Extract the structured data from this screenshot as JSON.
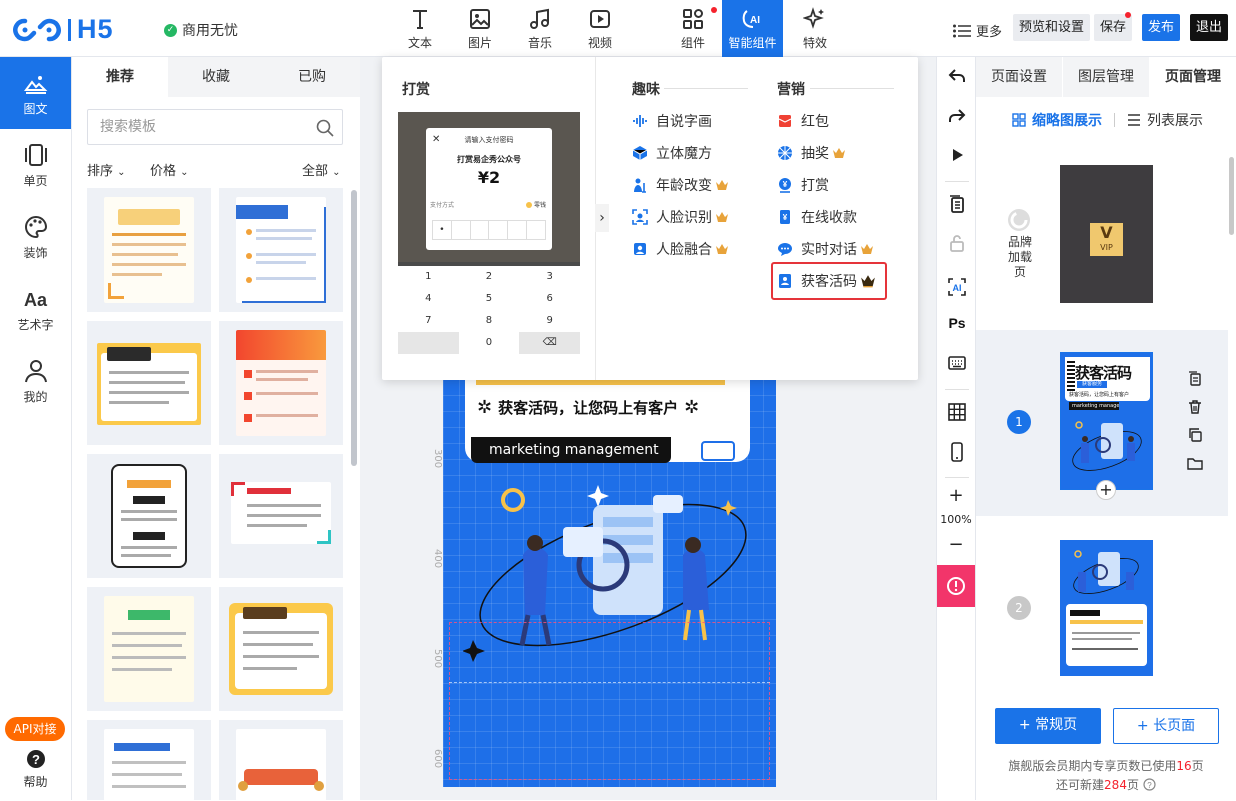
{
  "app": {
    "logo": "H5",
    "commercial": "商用无忧"
  },
  "toolbar": {
    "tools": [
      {
        "label": "文本",
        "icon": "text-icon"
      },
      {
        "label": "图片",
        "icon": "image-icon"
      },
      {
        "label": "音乐",
        "icon": "music-icon"
      },
      {
        "label": "视频",
        "icon": "video-icon"
      },
      {
        "label": "组件",
        "icon": "component-icon"
      },
      {
        "label": "智能组件",
        "icon": "ai-component-icon"
      },
      {
        "label": "特效",
        "icon": "effects-icon"
      }
    ],
    "more": "更多",
    "preview": "预览和设置",
    "save": "保存",
    "publish": "发布",
    "exit": "退出"
  },
  "leftnav": [
    {
      "label": "图文",
      "icon": "graphic-text-icon"
    },
    {
      "label": "单页",
      "icon": "single-page-icon"
    },
    {
      "label": "装饰",
      "icon": "palette-icon"
    },
    {
      "label": "艺术字",
      "icon": "art-text-icon"
    },
    {
      "label": "我的",
      "icon": "user-icon"
    }
  ],
  "leftnav_bottom": {
    "api": "API对接",
    "help": "帮助"
  },
  "templates": {
    "tabs": [
      "推荐",
      "收藏",
      "已购"
    ],
    "search_placeholder": "搜索模板",
    "filters": {
      "sort": "排序",
      "price": "价格",
      "all": "全部"
    }
  },
  "popup": {
    "reward": {
      "title": "打赏",
      "phone": {
        "header": "请输入支付密码",
        "merchant": "打赏易企秀公众号",
        "amount": "¥2",
        "method": "支付方式",
        "method_value": "零钱",
        "keys": [
          "1",
          "2",
          "3",
          "4",
          "5",
          "6",
          "7",
          "8",
          "9",
          "",
          "0",
          "⌫"
        ]
      }
    },
    "fun": {
      "title": "趣味",
      "items": [
        {
          "label": "自说字画",
          "icon": "voice-wave-icon",
          "crown": false
        },
        {
          "label": "立体魔方",
          "icon": "cube-icon",
          "crown": false
        },
        {
          "label": "年龄改变",
          "icon": "age-change-icon",
          "crown": true
        },
        {
          "label": "人脸识别",
          "icon": "face-recognition-icon",
          "crown": true
        },
        {
          "label": "人脸融合",
          "icon": "face-merge-icon",
          "crown": true
        }
      ]
    },
    "marketing": {
      "title": "营销",
      "items": [
        {
          "label": "红包",
          "icon": "red-envelope-icon",
          "crown": false
        },
        {
          "label": "抽奖",
          "icon": "lottery-icon",
          "crown": true
        },
        {
          "label": "打赏",
          "icon": "reward-icon",
          "crown": false
        },
        {
          "label": "在线收款",
          "icon": "payment-icon",
          "crown": false
        },
        {
          "label": "实时对话",
          "icon": "chat-icon",
          "crown": true
        },
        {
          "label": "获客活码",
          "icon": "qrcode-card-icon",
          "crown": true
        }
      ]
    }
  },
  "canvas": {
    "slogan": "获客活码，让您码上有客户",
    "subtitle": "marketing management",
    "ruler": [
      "300",
      "400",
      "500",
      "600"
    ]
  },
  "righttools": {
    "zoom": "100%"
  },
  "rightpanel": {
    "tabs": [
      "页面设置",
      "图层管理",
      "页面管理"
    ],
    "views": {
      "thumb": "缩略图展示",
      "list": "列表展示"
    },
    "loading_label": "品牌\n加载页",
    "vip": "VIP",
    "page1": {
      "num": "1",
      "title": "获客活码",
      "label": "获客服务",
      "sub": "获客活码，让您码上有客户",
      "tag": "marketing management"
    },
    "page2": {
      "num": "2"
    },
    "add_normal": "+ 常规页",
    "add_long": "+ 长页面",
    "quota_prefix": "旗舰版会员期内专享页数已使用",
    "quota_used": "16",
    "quota_unit": "页",
    "remain_prefix": "还可新建",
    "remain_count": "284",
    "remain_unit": "页"
  },
  "colors": {
    "brand": "#1a73e8",
    "danger": "#f5222d",
    "canvas_blue": "#1e6fe8",
    "vip": "#f0c86e"
  }
}
